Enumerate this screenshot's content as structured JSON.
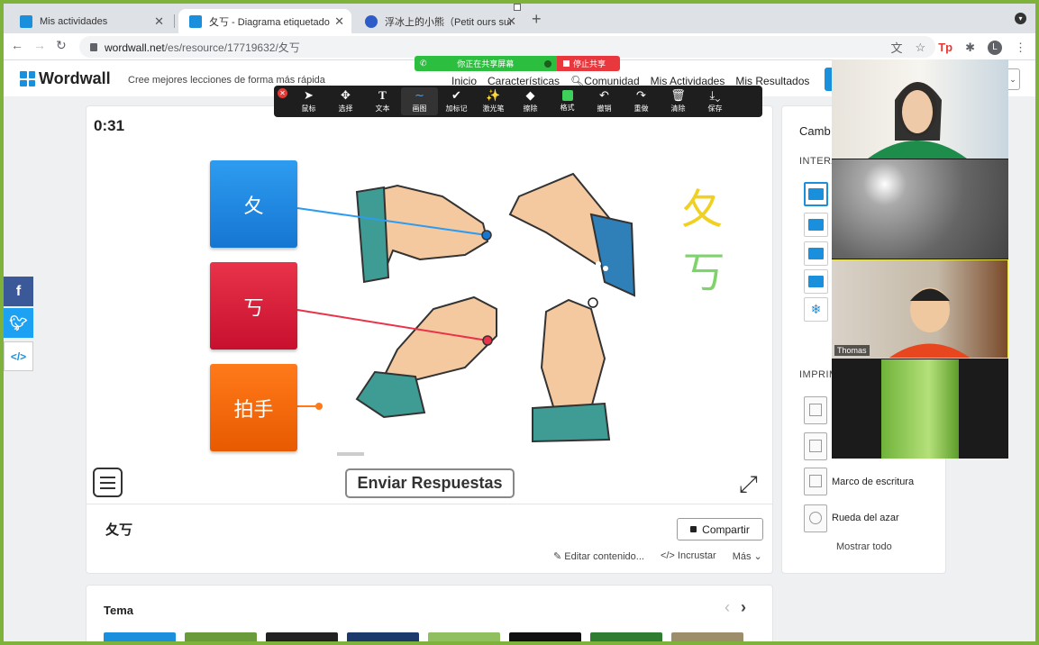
{
  "tabs": [
    {
      "title": "Mis actividades",
      "color": "#1a8fdc"
    },
    {
      "title": "夂丂 - Diagrama etiquetado",
      "color": "#1a8fdc"
    },
    {
      "title": "浮冰上的小熊（Petit ours sur la",
      "color": "#2d5bc7"
    }
  ],
  "address": {
    "host": "wordwall.net",
    "path": "/es/resource/17719632/夂丂"
  },
  "site": {
    "logo": "Wordwall",
    "tagline": "Cree mejores lecciones de forma más rápida",
    "nav": [
      "Inicio",
      "Características",
      "Comunidad",
      "Mis Actividades",
      "Mis Resultados"
    ]
  },
  "share_banner": {
    "sharing": "你正在共享屏幕",
    "stop": "停止共享"
  },
  "annotate_tools": [
    "鼠标",
    "选择",
    "文本",
    "画图",
    "加标记",
    "激光笔",
    "擦除",
    "格式",
    "撤销",
    "重做",
    "清除",
    "保存"
  ],
  "activity": {
    "timer": "0:31",
    "labels": [
      {
        "text": "夂",
        "color": "blue"
      },
      {
        "text": "丂",
        "color": "red"
      },
      {
        "text": "拍手",
        "color": "orange"
      }
    ],
    "handwriting": [
      "夂",
      "丂"
    ],
    "submit": "Enviar Respuestas",
    "title": "夂丂",
    "share": "Compartir",
    "edit": "Editar contenido...",
    "embed": "Incrustar",
    "more": "Más"
  },
  "tema": {
    "title": "Tema"
  },
  "right_panel": {
    "header": "Camb",
    "interactive_section": "INTERA",
    "print_section": "IMPRIM",
    "print_items": [
      "Marco de escritura",
      "Rueda del azar"
    ],
    "show_all": "Mostrar todo"
  },
  "video": {
    "participant_name": "Thomas"
  }
}
